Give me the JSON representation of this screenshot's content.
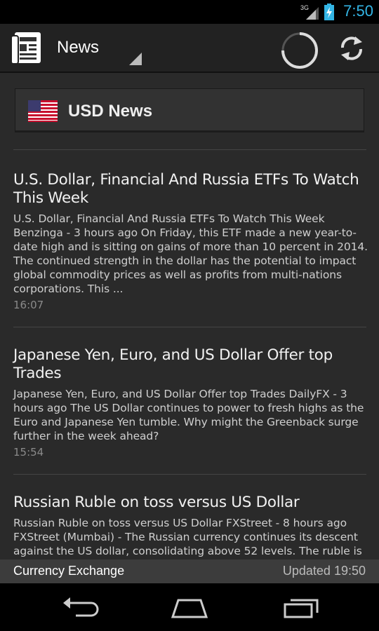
{
  "status_bar": {
    "network": "3G",
    "time": "7:50",
    "icons": [
      "signal-icon",
      "battery-charging-icon"
    ],
    "clock_color": "#33b5e5"
  },
  "action_bar": {
    "title": "News",
    "icons": [
      "news-app-icon",
      "dropdown-triangle-icon",
      "loading-spinner-icon",
      "refresh-icon"
    ]
  },
  "category": {
    "label": "USD News",
    "icon": "us-flag-icon"
  },
  "news": [
    {
      "title": "U.S. Dollar, Financial And Russia ETFs To Watch This Week",
      "body": "U.S. Dollar, Financial And Russia ETFs To Watch This Week Benzinga - 3 hours ago On Friday, this ETF made a new year-to-date high and is sitting on gains of more than 10 percent in 2014. The continued strength in the dollar has the potential to impact global commodity prices as well as profits from multi-nations corporations. This ...",
      "time": "16:07"
    },
    {
      "title": "Japanese Yen, Euro, and US Dollar Offer top Trades",
      "body": "Japanese Yen, Euro, and US Dollar Offer top Trades DailyFX - 3 hours ago The US Dollar continues to power to fresh highs as the Euro and Japanese Yen tumble. Why might the Greenback surge further in the week ahead?",
      "time": "15:54"
    },
    {
      "title": "Russian Ruble on toss versus US Dollar",
      "body": "Russian Ruble on toss versus US Dollar FXStreet - 8 hours ago FXStreet (Mumbai) - The Russian currency continues its descent against the US dollar, consolidating above 52 levels. The ruble is",
      "time": ""
    }
  ],
  "footer": {
    "app_name": "Currency Exchange",
    "updated": "Updated 19:50"
  },
  "nav_bar": {
    "icons": [
      "back-icon",
      "home-icon",
      "recent-apps-icon"
    ]
  }
}
